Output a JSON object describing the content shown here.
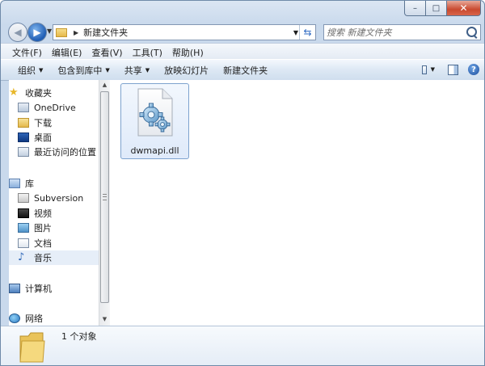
{
  "window": {
    "caption_buttons": {
      "minimize": "–",
      "maximize": "□",
      "close": "✕"
    }
  },
  "navigation": {
    "back_glyph": "◀",
    "forward_glyph": "▶",
    "address": {
      "separator": "▶",
      "path": "新建文件夹"
    },
    "search_placeholder": "搜索 新建文件夹"
  },
  "menubar": {
    "items": [
      {
        "label": "文件(F)"
      },
      {
        "label": "编辑(E)"
      },
      {
        "label": "查看(V)"
      },
      {
        "label": "工具(T)"
      },
      {
        "label": "帮助(H)"
      }
    ]
  },
  "toolbar": {
    "organize": "组织",
    "include_in_library": "包含到库中",
    "share": "共享",
    "slideshow": "放映幻灯片",
    "new_folder": "新建文件夹",
    "help_glyph": "?"
  },
  "sidebar": {
    "items": [
      {
        "label": "收藏夹",
        "icon": "favorites-star-icon"
      },
      {
        "label": "OneDrive",
        "icon": "onedrive-icon"
      },
      {
        "label": "下载",
        "icon": "downloads-folder-icon"
      },
      {
        "label": "桌面",
        "icon": "desktop-icon"
      },
      {
        "label": "最近访问的位置",
        "icon": "recent-places-icon"
      },
      {
        "label": "库",
        "icon": "libraries-icon"
      },
      {
        "label": "Subversion",
        "icon": "subversion-icon"
      },
      {
        "label": "视频",
        "icon": "videos-icon"
      },
      {
        "label": "图片",
        "icon": "pictures-icon"
      },
      {
        "label": "文档",
        "icon": "documents-icon"
      },
      {
        "label": "音乐",
        "icon": "music-icon",
        "selected": true
      },
      {
        "label": "计算机",
        "icon": "computer-icon"
      },
      {
        "label": "网络",
        "icon": "network-icon"
      }
    ]
  },
  "content": {
    "files": [
      {
        "name": "dwmapi.dll",
        "icon": "dll-gear-file-icon"
      }
    ]
  },
  "details": {
    "count": "1 个对象"
  },
  "colors": {
    "accent": "#1d5cb4",
    "selection_border": "#7da2ce",
    "selection_fill": "#dfeafa",
    "close_button": "#c9492f"
  }
}
